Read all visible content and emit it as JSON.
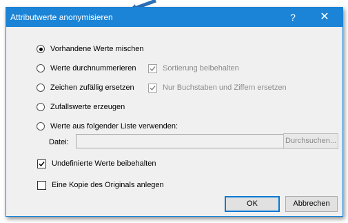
{
  "dialog": {
    "title": "Attributwerte anonymisieren",
    "help_glyph": "?",
    "close_glyph": "✕"
  },
  "options": {
    "shuffle": "Vorhandene Werte mischen",
    "number": "Werte durchnummerieren",
    "keep_sort": "Sortierung beibehalten",
    "replace_random": "Zeichen zufällig ersetzen",
    "only_letters": "Nur Buchstaben und Ziffern ersetzen",
    "random_values": "Zufallswerte erzeugen",
    "from_list": "Werte aus folgender Liste verwenden:"
  },
  "file": {
    "label": "Datei:",
    "value": "",
    "browse": "Durchsuchen..."
  },
  "checks": {
    "keep_undefined": "Undefinierte Werte beibehalten",
    "copy_original": "Eine Kopie des Originals anlegen"
  },
  "buttons": {
    "ok": "OK",
    "cancel": "Abbrechen"
  },
  "colors": {
    "titlebar": "#1c84d6",
    "disabled_text": "#8a8a8a"
  }
}
